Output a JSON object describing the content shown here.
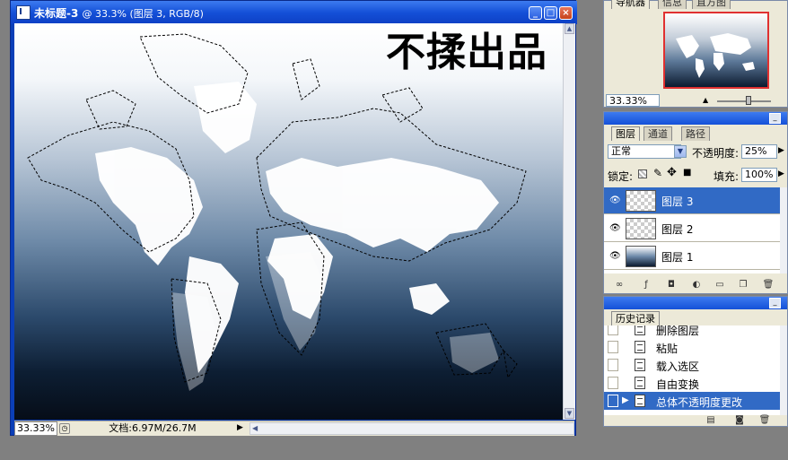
{
  "document": {
    "title": "未标题-3",
    "title_info": "@ 33.3% (图层 3, RGB/8)",
    "watermark": "不揉出品",
    "zoom": "33.33%",
    "doc_info": "文档:6.97M/26.7M"
  },
  "navigator": {
    "tabs": [
      "导航器",
      "信息",
      "直方图"
    ],
    "zoom": "33.33%"
  },
  "layers_panel": {
    "tabs": [
      "图层",
      "通道",
      "路径"
    ],
    "blend_mode": "正常",
    "opacity_label": "不透明度:",
    "opacity_value": "25%",
    "lock_label": "锁定:",
    "fill_label": "填充:",
    "fill_value": "100%",
    "layers": [
      {
        "name": "图层 3",
        "selected": true
      },
      {
        "name": "图层 2",
        "selected": false
      },
      {
        "name": "图层 1",
        "selected": false
      }
    ]
  },
  "history_panel": {
    "tab": "历史记录",
    "items": [
      "删除图层",
      "粘贴",
      "载入选区",
      "自由变换",
      "总体不透明度更改"
    ],
    "selected_index": 4
  },
  "colors": {
    "titlebar": "#1450d8",
    "selection": "#316ac5",
    "panel": "#ece9d8"
  }
}
